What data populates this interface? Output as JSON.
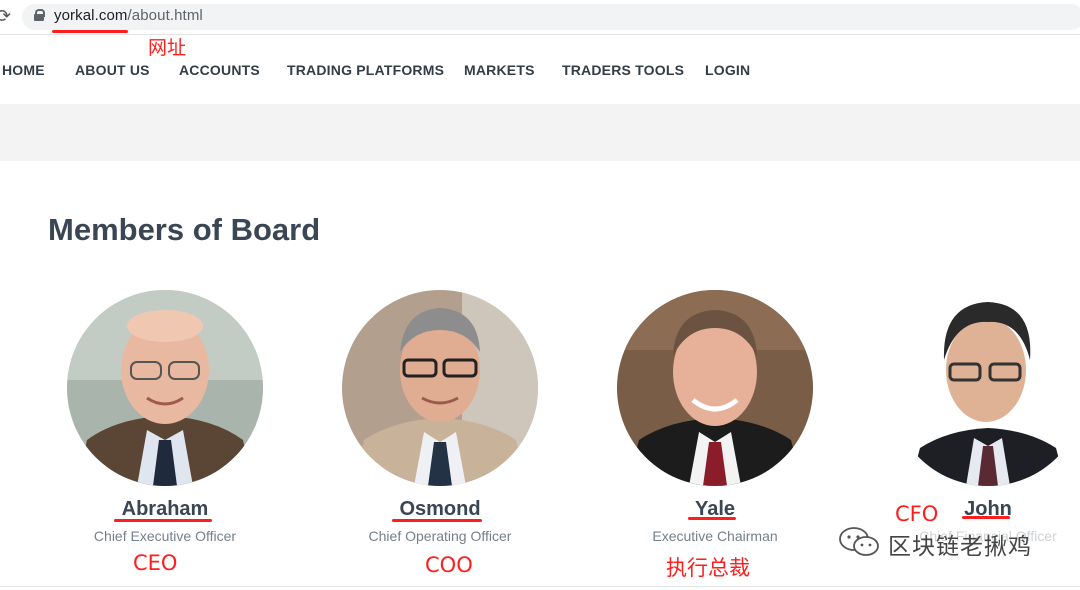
{
  "browser": {
    "url_domain": "yorkal.com",
    "url_path": "/about.html"
  },
  "annotations": {
    "url_note": "网址",
    "ceo": "CEO",
    "coo": "COO",
    "exec_chair": "执行总裁",
    "cfo": "CFO",
    "color": "#ff1e1e"
  },
  "nav": {
    "items": [
      "HOME",
      "ABOUT US",
      "ACCOUNTS",
      "TRADING PLATFORMS",
      "MARKETS",
      "TRADERS TOOLS",
      "LOGIN"
    ]
  },
  "section": {
    "title": "Members of Board"
  },
  "members": [
    {
      "name": "Abraham",
      "role": "Chief Executive Officer"
    },
    {
      "name": "Osmond",
      "role": "Chief Operating Officer"
    },
    {
      "name": "Yale",
      "role": "Executive Chairman"
    },
    {
      "name": "John",
      "role": "Chief Financial Officer"
    }
  ],
  "watermark": {
    "text": "区块链老揪鸡",
    "icon": "wechat-icon"
  }
}
